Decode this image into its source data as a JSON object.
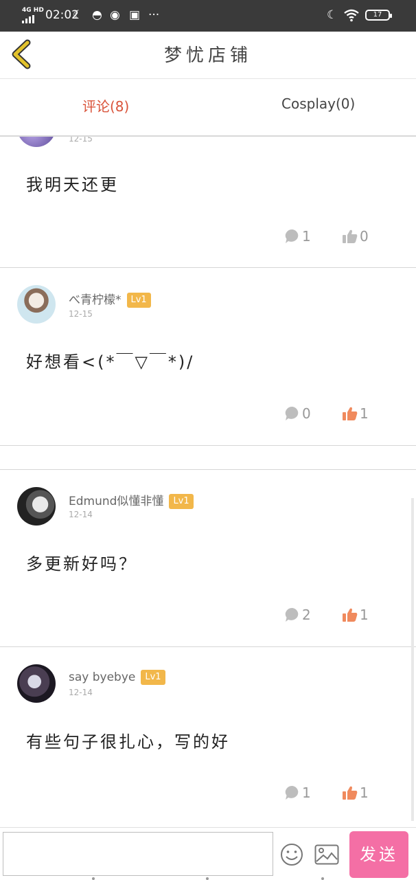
{
  "status_bar": {
    "network": "4G HD",
    "time": "02:02",
    "battery": "17"
  },
  "header": {
    "title": "梦忧店铺",
    "back_icon": "chevron-left-icon"
  },
  "tabs": [
    {
      "label": "评论(8)",
      "active": true
    },
    {
      "label": "Cosplay(0)",
      "active": false
    }
  ],
  "comments": [
    {
      "user": "",
      "level": "",
      "date": "12-15",
      "text": "我明天还更",
      "reply_count": "1",
      "like_count": "0",
      "liked": false
    },
    {
      "user": "べ青柠檬*",
      "level": "Lv1",
      "date": "12-15",
      "text": "好想看<(*￣▽￣*)/",
      "reply_count": "0",
      "like_count": "1",
      "liked": true
    },
    {
      "user": "Edmund似懂非懂",
      "level": "Lv1",
      "date": "12-14",
      "text": "多更新好吗？",
      "reply_count": "2",
      "like_count": "1",
      "liked": true
    },
    {
      "user": "say byebye",
      "level": "Lv1",
      "date": "12-14",
      "text": "有些句子很扎心，写的好",
      "reply_count": "1",
      "like_count": "1",
      "liked": true
    }
  ],
  "bottom_bar": {
    "input_placeholder": "",
    "send_label": "发送"
  },
  "colors": {
    "accent_tab": "#d9533a",
    "level_badge": "#f2b74a",
    "send_button": "#f46fa5",
    "liked": "#f08a5d",
    "back_icon": "#e2c22b"
  }
}
